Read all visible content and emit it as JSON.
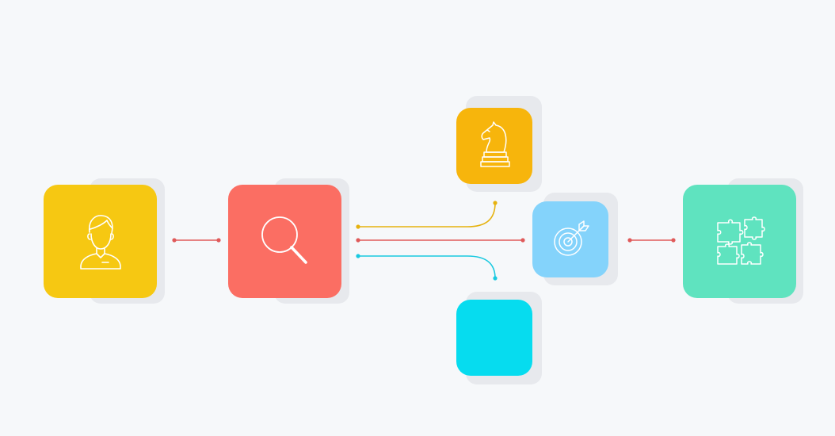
{
  "colors": {
    "background": "#f6f8fa",
    "tile_shadow": "#e7e9ed",
    "user": "#f6c812",
    "search": "#fb6e63",
    "strategy": "#f7b50c",
    "target": "#84d3fb",
    "plain": "#06dcef",
    "puzzle": "#5fe3bf",
    "connector_red": "#e05a5a",
    "connector_yellow": "#e6b20e",
    "connector_cyan": "#19c9e0"
  },
  "diagram": {
    "nodes": [
      {
        "id": "user",
        "icon": "user-icon"
      },
      {
        "id": "search",
        "icon": "magnifier-icon"
      },
      {
        "id": "strategy",
        "icon": "chess-knight-icon"
      },
      {
        "id": "target",
        "icon": "target-icon"
      },
      {
        "id": "plain",
        "icon": ""
      },
      {
        "id": "puzzle",
        "icon": "puzzle-icon"
      }
    ],
    "edges": [
      {
        "from": "user",
        "to": "search",
        "color": "connector_red"
      },
      {
        "from": "search",
        "to": "strategy",
        "color": "connector_yellow"
      },
      {
        "from": "search",
        "to": "target",
        "color": "connector_red"
      },
      {
        "from": "search",
        "to": "plain",
        "color": "connector_cyan"
      },
      {
        "from": "target",
        "to": "puzzle",
        "color": "connector_red"
      }
    ]
  }
}
